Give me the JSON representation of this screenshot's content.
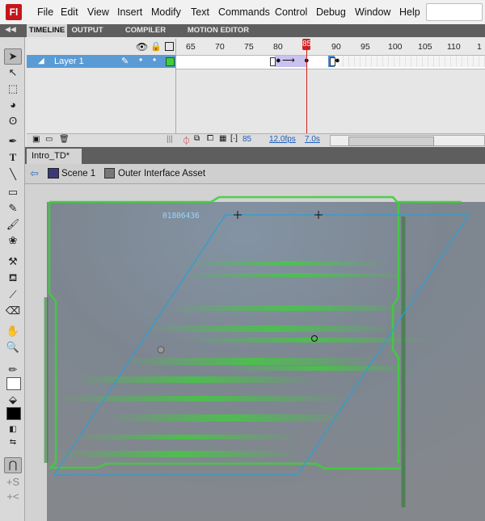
{
  "app": {
    "logo": "Fl"
  },
  "menu": [
    "File",
    "Edit",
    "View",
    "Insert",
    "Modify",
    "Text",
    "Commands",
    "Control",
    "Debug",
    "Window",
    "Help"
  ],
  "panel_tabs": [
    "TIMELINE",
    "OUTPUT",
    "COMPILER ERRORS",
    "MOTION EDITOR"
  ],
  "timeline": {
    "ruler": [
      "65",
      "70",
      "75",
      "80",
      "85",
      "90",
      "95",
      "100",
      "105",
      "110",
      "1"
    ],
    "layer_name": "Layer 1",
    "current_frame": "85",
    "footer_frame": "85",
    "fps": "12.0fps",
    "time": "7.0s"
  },
  "document": {
    "tab": "Intro_TD*",
    "close": "×",
    "scene": "Scene 1",
    "symbol": "Outer Interface Asset"
  },
  "stage": {
    "readout": "01806436"
  },
  "colors": {
    "accent": "#5b9bd5",
    "playhead": "#cc2020",
    "glow": "#3ecf3a",
    "transform": "#2a9fd6"
  }
}
